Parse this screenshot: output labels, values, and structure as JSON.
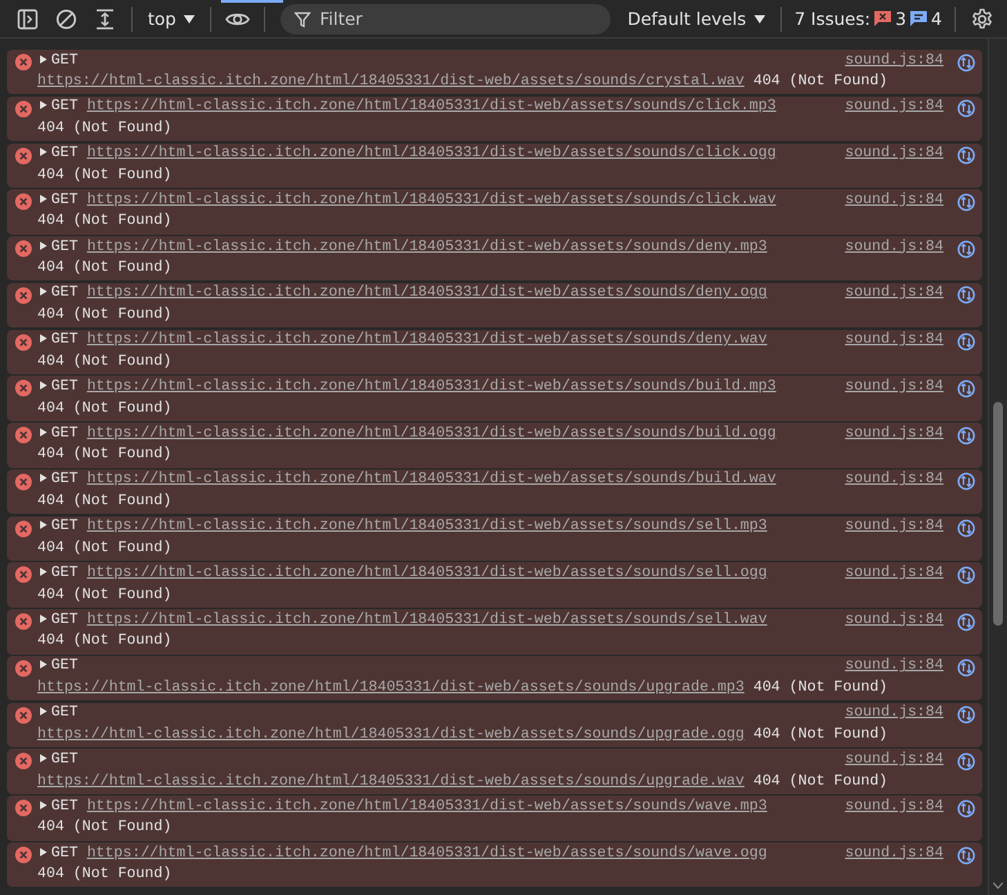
{
  "toolbar": {
    "context": "top",
    "filter": {
      "placeholder": "Filter"
    },
    "levels": "Default levels",
    "issues": {
      "label": "7 Issues:",
      "errors": "3",
      "info": "4"
    }
  },
  "messages": [
    {
      "kind": "wrapped",
      "method": "GET",
      "url": "https://html-classic.itch.zone/html/18405331/dist-web/assets/sounds/crystal.wav",
      "status": "404 (Not Found)",
      "source": "sound.js:84"
    },
    {
      "kind": "inline",
      "method": "GET",
      "url": "https://html-classic.itch.zone/html/18405331/dist-web/assets/sounds/click.mp3",
      "status": "404 (Not Found)",
      "source": "sound.js:84"
    },
    {
      "kind": "inline",
      "method": "GET",
      "url": "https://html-classic.itch.zone/html/18405331/dist-web/assets/sounds/click.ogg",
      "status": "404 (Not Found)",
      "source": "sound.js:84"
    },
    {
      "kind": "inline",
      "method": "GET",
      "url": "https://html-classic.itch.zone/html/18405331/dist-web/assets/sounds/click.wav",
      "status": "404 (Not Found)",
      "source": "sound.js:84"
    },
    {
      "kind": "inline",
      "method": "GET",
      "url": "https://html-classic.itch.zone/html/18405331/dist-web/assets/sounds/deny.mp3",
      "status": "404 (Not Found)",
      "source": "sound.js:84"
    },
    {
      "kind": "inline",
      "method": "GET",
      "url": "https://html-classic.itch.zone/html/18405331/dist-web/assets/sounds/deny.ogg",
      "status": "404 (Not Found)",
      "source": "sound.js:84"
    },
    {
      "kind": "inline",
      "method": "GET",
      "url": "https://html-classic.itch.zone/html/18405331/dist-web/assets/sounds/deny.wav",
      "status": "404 (Not Found)",
      "source": "sound.js:84"
    },
    {
      "kind": "inline",
      "method": "GET",
      "url": "https://html-classic.itch.zone/html/18405331/dist-web/assets/sounds/build.mp3",
      "status": "404 (Not Found)",
      "source": "sound.js:84"
    },
    {
      "kind": "inline",
      "method": "GET",
      "url": "https://html-classic.itch.zone/html/18405331/dist-web/assets/sounds/build.ogg",
      "status": "404 (Not Found)",
      "source": "sound.js:84"
    },
    {
      "kind": "inline",
      "method": "GET",
      "url": "https://html-classic.itch.zone/html/18405331/dist-web/assets/sounds/build.wav",
      "status": "404 (Not Found)",
      "source": "sound.js:84"
    },
    {
      "kind": "inline",
      "method": "GET",
      "url": "https://html-classic.itch.zone/html/18405331/dist-web/assets/sounds/sell.mp3",
      "status": "404 (Not Found)",
      "source": "sound.js:84"
    },
    {
      "kind": "inline",
      "method": "GET",
      "url": "https://html-classic.itch.zone/html/18405331/dist-web/assets/sounds/sell.ogg",
      "status": "404 (Not Found)",
      "source": "sound.js:84"
    },
    {
      "kind": "inline",
      "method": "GET",
      "url": "https://html-classic.itch.zone/html/18405331/dist-web/assets/sounds/sell.wav",
      "status": "404 (Not Found)",
      "source": "sound.js:84"
    },
    {
      "kind": "wrapped",
      "method": "GET",
      "url": "https://html-classic.itch.zone/html/18405331/dist-web/assets/sounds/upgrade.mp3",
      "status": "404 (Not Found)",
      "source": "sound.js:84"
    },
    {
      "kind": "wrapped",
      "method": "GET",
      "url": "https://html-classic.itch.zone/html/18405331/dist-web/assets/sounds/upgrade.ogg",
      "status": "404 (Not Found)",
      "source": "sound.js:84"
    },
    {
      "kind": "wrapped",
      "method": "GET",
      "url": "https://html-classic.itch.zone/html/18405331/dist-web/assets/sounds/upgrade.wav",
      "status": "404 (Not Found)",
      "source": "sound.js:84"
    },
    {
      "kind": "inline",
      "method": "GET",
      "url": "https://html-classic.itch.zone/html/18405331/dist-web/assets/sounds/wave.mp3",
      "status": "404 (Not Found)",
      "source": "sound.js:84"
    },
    {
      "kind": "inline",
      "method": "GET",
      "url": "https://html-classic.itch.zone/html/18405331/dist-web/assets/sounds/wave.ogg",
      "status": "404 (Not Found)",
      "source": "sound.js:84"
    }
  ]
}
